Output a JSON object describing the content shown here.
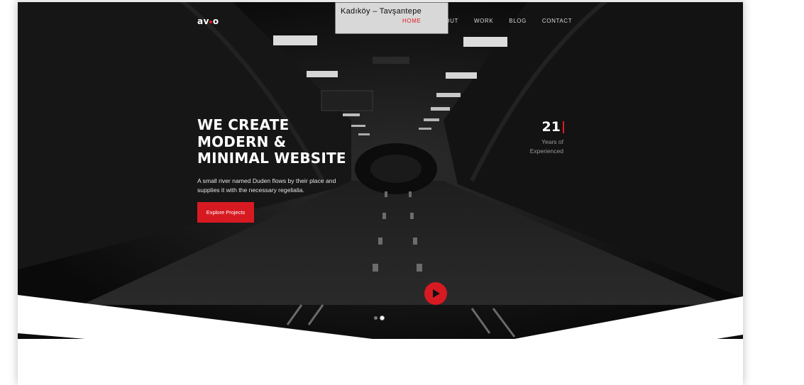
{
  "brand": {
    "logo_left": "av",
    "logo_right": "o",
    "accent": "#e31b23"
  },
  "background": {
    "sign_text": "Kadıköy  –  Tavşantepe"
  },
  "nav": {
    "items": [
      {
        "label": "HOME",
        "active": true
      },
      {
        "label": "ABOUT",
        "active": false
      },
      {
        "label": "WORK",
        "active": false
      },
      {
        "label": "BLOG",
        "active": false
      },
      {
        "label": "CONTACT",
        "active": false
      }
    ]
  },
  "hero": {
    "headline": [
      "WE CREATE",
      "MODERN &",
      "MINIMAL WEBSITE"
    ],
    "lead": "A small river named Duden flows by their place and supplies it with the necessary regelialia.",
    "cta_label": "Explore Projects"
  },
  "counter": {
    "number": "21",
    "label_line1": "Years of",
    "label_line2": "Experienced"
  },
  "slider": {
    "active_index": 1,
    "count": 2
  },
  "icons": {
    "play": "play-icon"
  }
}
